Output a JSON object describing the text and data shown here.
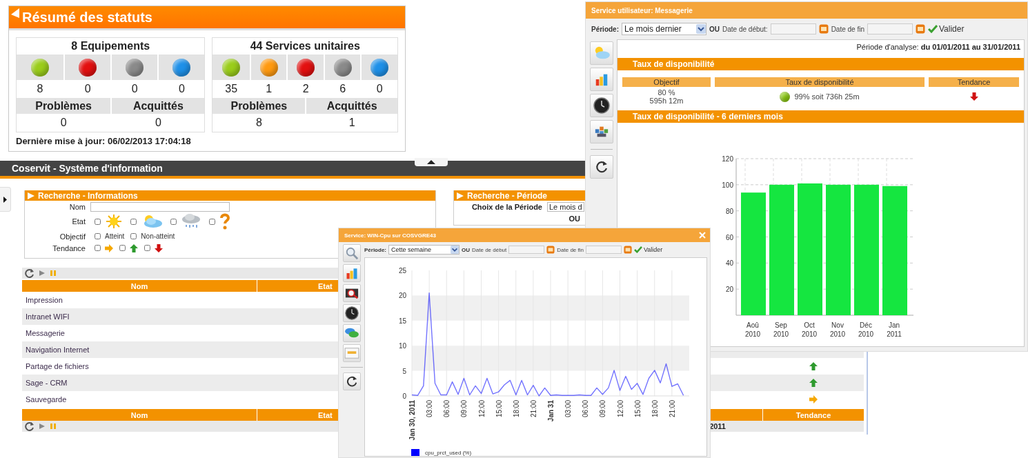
{
  "status_summary": {
    "title": "Résumé des statuts",
    "groups": [
      {
        "title": "8 Equipements",
        "states": [
          {
            "color": "#9acd1a",
            "count": "8"
          },
          {
            "color": "#e31010",
            "count": "0"
          },
          {
            "color": "#8a8a8a",
            "count": "0"
          },
          {
            "color": "#1e90e8",
            "count": "0"
          }
        ],
        "problems_label": "Problèmes",
        "problems": "0",
        "ack_label": "Acquittés",
        "ack": "0"
      },
      {
        "title": "44 Services unitaires",
        "states": [
          {
            "color": "#9acd1a",
            "count": "35"
          },
          {
            "color": "#ff9a10",
            "count": "1"
          },
          {
            "color": "#e31010",
            "count": "2"
          },
          {
            "color": "#8a8a8a",
            "count": "6"
          },
          {
            "color": "#1e90e8",
            "count": "0"
          }
        ],
        "problems_label": "Problèmes",
        "problems": "8",
        "ack_label": "Acquittés",
        "ack": "1"
      }
    ],
    "last_update": "Dernière mise à jour: 06/02/2013 17:04:18"
  },
  "main_window": {
    "title": "Coservit - Système d'information",
    "search_info": {
      "title": "Recherche - Informations",
      "name_label": "Nom",
      "state_label": "Etat",
      "state_options": [
        {
          "kind": "sunny",
          "checked": false
        },
        {
          "kind": "cloudy",
          "checked": false
        },
        {
          "kind": "rainy",
          "checked": false
        },
        {
          "kind": "unknown",
          "checked": false
        }
      ],
      "objective_label": "Objectif",
      "objective_options": [
        {
          "label": "Atteint",
          "checked": false
        },
        {
          "label": "Non-atteint",
          "checked": false
        }
      ],
      "trend_label": "Tendance",
      "trend_options": [
        {
          "kind": "flat",
          "checked": false
        },
        {
          "kind": "up",
          "checked": false
        },
        {
          "kind": "down",
          "checked": false
        }
      ]
    },
    "search_period": {
      "title": "Recherche - Période",
      "choice_label": "Choix de la Période",
      "choice_value": "Le mois d",
      "or_label": "OU"
    },
    "table": {
      "header": [
        "Nom",
        "Etat"
      ],
      "rows": [
        {
          "name": "Impression"
        },
        {
          "name": "Intranet WIFI"
        },
        {
          "name": "Messagerie"
        },
        {
          "name": "Navigation Internet"
        },
        {
          "name": "Partage de fichiers",
          "trend": {
            "kind": "up"
          }
        },
        {
          "name": "Sage - CRM",
          "trend": {
            "kind": "up"
          }
        },
        {
          "name": "Sauvegarde",
          "trend": {
            "kind": "flat"
          }
        }
      ],
      "footer_header": [
        "Nom",
        "Etat",
        "Tendance"
      ],
      "footer_text": "2011"
    }
  },
  "messagerie_window": {
    "title": "Service utilisateur: Messagerie",
    "period_label": "Période:",
    "period_value": "Le mois dernier",
    "or_label": "OU",
    "start_label": "Date de début:",
    "end_label": "Date de fin",
    "validate": "Valider",
    "analysis": "Période d'analyse: **du 01/01/2011 au 31/01/2011**",
    "section_1": "Taux de disponibilité",
    "columns": [
      "Objectif",
      "Taux de disponibilité",
      "Tendance"
    ],
    "objective": [
      "80 %",
      "595h 12m"
    ],
    "availability": "99% soit 736h 25m",
    "trend": {
      "kind": "down"
    },
    "section_2": "Taux de disponibilité - 6 derniers mois",
    "chart_data": {
      "type": "bar",
      "categories": [
        "Aoû 2010",
        "Sep 2010",
        "Oct 2010",
        "Nov 2010",
        "Déc 2010",
        "Jan 2011"
      ],
      "series": [
        {
          "color": "#15e640",
          "values": [
            94,
            100,
            101,
            100,
            100,
            99
          ]
        }
      ],
      "ylim": [
        0,
        120
      ],
      "yticks": [
        20,
        40,
        60,
        80,
        100,
        120
      ],
      "grid": true
    }
  },
  "cpu_window": {
    "title": "Service: WIN-Cpu sur COSVGRE43",
    "period_label": "Période:",
    "period_value": "Cette semaine",
    "or_label": "OU",
    "start_label": "Date de début",
    "end_label": "Date de fin",
    "validate": "Valider",
    "chart_data": {
      "type": "line",
      "x": [
        "2011-01-30T00:00",
        "2011-01-30T01:00",
        "2011-01-30T02:00",
        "2011-01-30T03:00",
        "2011-01-30T04:00",
        "2011-01-30T05:00",
        "2011-01-30T06:00",
        "2011-01-30T07:00",
        "2011-01-30T08:00",
        "2011-01-30T09:00",
        "2011-01-30T10:00",
        "2011-01-30T11:00",
        "2011-01-30T12:00",
        "2011-01-30T13:00",
        "2011-01-30T14:00",
        "2011-01-30T15:00",
        "2011-01-30T16:00",
        "2011-01-30T17:00",
        "2011-01-30T18:00",
        "2011-01-30T19:00",
        "2011-01-30T20:00",
        "2011-01-30T21:00",
        "2011-01-30T22:00",
        "2011-01-30T23:00",
        "2011-01-31T00:00",
        "2011-01-31T01:00",
        "2011-01-31T02:00",
        "2011-01-31T03:00",
        "2011-01-31T04:00",
        "2011-01-31T05:00",
        "2011-01-31T06:00",
        "2011-01-31T07:00",
        "2011-01-31T08:00",
        "2011-01-31T09:00",
        "2011-01-31T10:00",
        "2011-01-31T11:00",
        "2011-01-31T12:00",
        "2011-01-31T13:00",
        "2011-01-31T14:00",
        "2011-01-31T15:00",
        "2011-01-31T16:00",
        "2011-01-31T17:00",
        "2011-01-31T18:00",
        "2011-01-31T19:00",
        "2011-01-31T20:00",
        "2011-01-31T21:00",
        "2011-01-31T22:00",
        "2011-01-31T23:00"
      ],
      "series": [
        {
          "name": "cpu_prct_used (%)",
          "color": "#0000ff",
          "values": [
            0.2,
            0.1,
            2,
            20.5,
            2.5,
            0.2,
            0.2,
            2.8,
            0.3,
            3.5,
            0.2,
            2,
            0.5,
            3.5,
            0.4,
            0.8,
            2.2,
            3.1,
            0.2,
            3.1,
            0.2,
            2.1,
            0,
            1.6,
            0.1,
            0.2,
            0.1,
            0.1,
            0.1,
            0.2,
            0.1,
            0.1,
            1.6,
            0.3,
            1.6,
            5.1,
            1.1,
            3.9,
            1.3,
            2.5,
            0.3,
            3.5,
            5.1,
            2.6,
            6.4,
            1.9,
            2.4,
            0.1
          ]
        }
      ],
      "xlim": [
        "2011-01-30T00:00",
        "2011-02-01T00:00"
      ],
      "ylim": [
        0,
        25
      ],
      "yticks": [
        0,
        5,
        10,
        15,
        20,
        25
      ],
      "grid": true,
      "xticks": [
        {
          "value": "2011-01-30T00:00",
          "label": "Jan 30, 2011"
        },
        {
          "value": "2011-01-30T03:00",
          "label": "03:00"
        },
        {
          "value": "2011-01-30T06:00",
          "label": "06:00"
        },
        {
          "value": "2011-01-30T09:00",
          "label": "09:00"
        },
        {
          "value": "2011-01-30T12:00",
          "label": "12:00"
        },
        {
          "value": "2011-01-30T15:00",
          "label": "15:00"
        },
        {
          "value": "2011-01-30T18:00",
          "label": "18:00"
        },
        {
          "value": "2011-01-30T21:00",
          "label": "21:00"
        },
        {
          "value": "2011-01-31T00:00",
          "label": "Jan 31"
        },
        {
          "value": "2011-01-31T03:00",
          "label": "03:00"
        },
        {
          "value": "2011-01-31T06:00",
          "label": "06:00"
        },
        {
          "value": "2011-01-31T09:00",
          "label": "09:00"
        },
        {
          "value": "2011-01-31T12:00",
          "label": "12:00"
        },
        {
          "value": "2011-01-31T15:00",
          "label": "15:00"
        },
        {
          "value": "2011-01-31T18:00",
          "label": "18:00"
        },
        {
          "value": "2011-01-31T21:00",
          "label": "21:00"
        }
      ]
    }
  }
}
